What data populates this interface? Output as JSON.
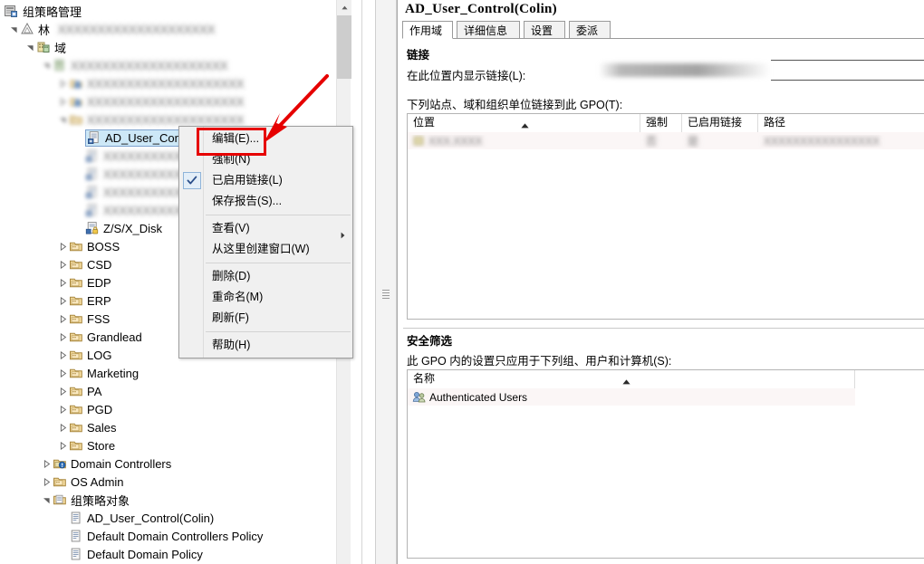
{
  "app": {
    "title": "组策略管理",
    "root_icon": "console-root-icon"
  },
  "tree": {
    "nodes": [
      {
        "label": "林",
        "redacted_suffix": true,
        "icon": "forest-icon",
        "indent": 0,
        "expander": "expanded"
      },
      {
        "label": "域",
        "redacted_suffix": false,
        "icon": "domains-icon",
        "indent": 1,
        "expander": "expanded"
      },
      {
        "label": "",
        "redacted": true,
        "icon": "domain-icon",
        "indent": 2,
        "expander": "expanded"
      },
      {
        "label": "",
        "redacted": true,
        "icon": "ou-users-icon",
        "indent": 3,
        "expander": "collapsed"
      },
      {
        "label": "",
        "redacted": true,
        "icon": "ou-users-icon",
        "indent": 3,
        "expander": "collapsed"
      },
      {
        "label": "",
        "redacted": true,
        "icon": "ou-folder-icon",
        "indent": 3,
        "expander": "expanded"
      },
      {
        "label": "AD_User_Control(Colin)",
        "icon": "gpo-link-icon",
        "indent": 4,
        "expander": "none",
        "selected": true
      },
      {
        "label": "",
        "redacted": true,
        "icon": "gpo-link-icon",
        "indent": 4,
        "expander": "none"
      },
      {
        "label": "",
        "redacted": true,
        "icon": "gpo-link-icon",
        "indent": 4,
        "expander": "none"
      },
      {
        "label": "",
        "redacted": true,
        "icon": "gpo-link-icon",
        "indent": 4,
        "expander": "none"
      },
      {
        "label": "",
        "redacted": true,
        "icon": "gpo-link-icon",
        "indent": 4,
        "expander": "none"
      },
      {
        "label": "Z/S/X_Disk",
        "icon": "gpo-link-enforced-icon",
        "indent": 4,
        "expander": "none"
      },
      {
        "label": "BOSS",
        "icon": "ou-folder-icon",
        "indent": 3,
        "expander": "collapsed"
      },
      {
        "label": "CSD",
        "icon": "ou-folder-icon",
        "indent": 3,
        "expander": "collapsed"
      },
      {
        "label": "EDP",
        "icon": "ou-folder-icon",
        "indent": 3,
        "expander": "collapsed"
      },
      {
        "label": "ERP",
        "icon": "ou-folder-icon",
        "indent": 3,
        "expander": "collapsed"
      },
      {
        "label": "FSS",
        "icon": "ou-folder-icon",
        "indent": 3,
        "expander": "collapsed"
      },
      {
        "label": "Grandlead",
        "icon": "ou-folder-icon",
        "indent": 3,
        "expander": "collapsed"
      },
      {
        "label": "LOG",
        "icon": "ou-folder-icon",
        "indent": 3,
        "expander": "collapsed"
      },
      {
        "label": "Marketing",
        "icon": "ou-folder-icon",
        "indent": 3,
        "expander": "collapsed"
      },
      {
        "label": "PA",
        "icon": "ou-folder-icon",
        "indent": 3,
        "expander": "collapsed"
      },
      {
        "label": "PGD",
        "icon": "ou-folder-icon",
        "indent": 3,
        "expander": "collapsed"
      },
      {
        "label": "Sales",
        "icon": "ou-folder-icon",
        "indent": 3,
        "expander": "collapsed"
      },
      {
        "label": "Store",
        "icon": "ou-folder-icon",
        "indent": 3,
        "expander": "collapsed"
      },
      {
        "label": "Domain Controllers",
        "icon": "domain-controllers-icon",
        "indent": 2,
        "expander": "collapsed"
      },
      {
        "label": "OS Admin",
        "icon": "ou-folder-icon",
        "indent": 2,
        "expander": "collapsed"
      },
      {
        "label": "组策略对象",
        "icon": "gpo-container-icon",
        "indent": 2,
        "expander": "expanded"
      },
      {
        "label": "AD_User_Control(Colin)",
        "icon": "gpo-icon",
        "indent": 3,
        "expander": "none"
      },
      {
        "label": "Default Domain Controllers Policy",
        "icon": "gpo-icon",
        "indent": 3,
        "expander": "none"
      },
      {
        "label": "Default Domain Policy",
        "icon": "gpo-icon",
        "indent": 3,
        "expander": "none"
      }
    ]
  },
  "context_menu": {
    "items": [
      {
        "label": "编辑(E)...",
        "checked": false,
        "submenu": false,
        "highlighted": true
      },
      {
        "label": "强制(N)",
        "checked": false,
        "submenu": false
      },
      {
        "label": "已启用链接(L)",
        "checked": true,
        "submenu": false
      },
      {
        "label": "保存报告(S)...",
        "checked": false,
        "submenu": false
      },
      {
        "separator": true
      },
      {
        "label": "查看(V)",
        "checked": false,
        "submenu": true
      },
      {
        "label": "从这里创建窗口(W)",
        "checked": false,
        "submenu": false
      },
      {
        "separator": true
      },
      {
        "label": "删除(D)",
        "checked": false,
        "submenu": false
      },
      {
        "label": "重命名(M)",
        "checked": false,
        "submenu": false
      },
      {
        "label": "刷新(F)",
        "checked": false,
        "submenu": false
      },
      {
        "separator": true
      },
      {
        "label": "帮助(H)",
        "checked": false,
        "submenu": false
      }
    ]
  },
  "details": {
    "title": "AD_User_Control(Colin)",
    "tabs": [
      {
        "label": "作用域",
        "selected": true
      },
      {
        "label": "详细信息",
        "selected": false
      },
      {
        "label": "设置",
        "selected": false
      },
      {
        "label": "委派",
        "selected": false
      }
    ],
    "links": {
      "heading": "链接",
      "scope_label": "在此位置内显示链接(L):",
      "scope_value": "",
      "scope_value_redacted": true,
      "list_label": "下列站点、域和组织单位链接到此 GPO(T):",
      "columns": [
        {
          "label": "位置",
          "sorted": "asc"
        },
        {
          "label": "强制",
          "sorted": ""
        },
        {
          "label": "已启用链接",
          "sorted": ""
        },
        {
          "label": "路径",
          "sorted": ""
        }
      ],
      "rows": [
        {
          "location": "",
          "enforced": "",
          "link_enabled": "",
          "path": "",
          "redacted": true
        }
      ]
    },
    "security_filtering": {
      "heading": "安全筛选",
      "description": "此 GPO 内的设置只应用于下列组、用户和计算机(S):",
      "columns": [
        {
          "label": "名称",
          "sorted": "asc"
        }
      ],
      "rows": [
        {
          "name": "Authenticated Users",
          "icon": "users-group-icon"
        }
      ]
    }
  },
  "annotation": {
    "color": "#e60000",
    "target": "编辑(E)..."
  }
}
